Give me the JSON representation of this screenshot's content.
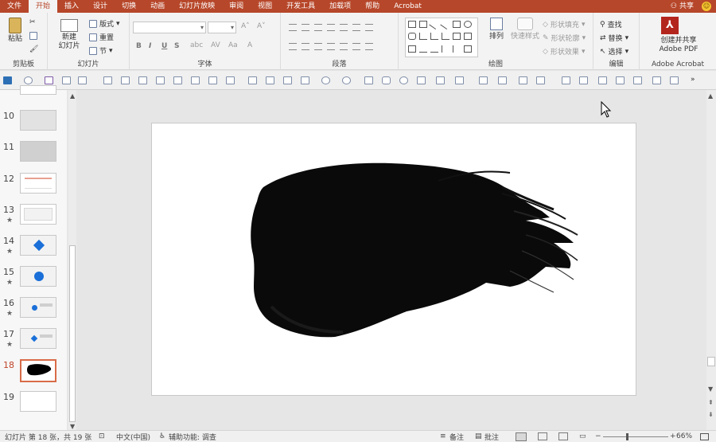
{
  "tabs": [
    "文件",
    "开始",
    "插入",
    "设计",
    "切换",
    "动画",
    "幻灯片放映",
    "审阅",
    "视图",
    "开发工具",
    "加载项",
    "帮助",
    "Acrobat"
  ],
  "active_tab": "开始",
  "share_label": "共享",
  "ribbon": {
    "clipboard": {
      "paste": "粘贴",
      "label": "剪贴板"
    },
    "slides": {
      "new_slide_line1": "新建",
      "new_slide_line2": "幻灯片",
      "layout": "版式",
      "reset": "重置",
      "section": "节",
      "label": "幻灯片"
    },
    "font": {
      "bold": "B",
      "italic": "I",
      "underline": "U",
      "strike": "S",
      "label": "字体"
    },
    "paragraph": {
      "label": "段落"
    },
    "drawing": {
      "arrange": "排列",
      "quick_styles": "快速样式",
      "shape_fill": "形状填充",
      "shape_outline": "形状轮廓",
      "shape_effects": "形状效果",
      "label": "绘图"
    },
    "editing": {
      "find": "查找",
      "replace": "替换",
      "select": "选择",
      "label": "编辑"
    },
    "acrobat": {
      "create_line1": "创建并共享",
      "create_line2": "Adobe PDF",
      "label": "Adobe Acrobat"
    }
  },
  "thumbnails": [
    {
      "num": "10",
      "star": ""
    },
    {
      "num": "11",
      "star": ""
    },
    {
      "num": "12",
      "star": ""
    },
    {
      "num": "13",
      "star": "★"
    },
    {
      "num": "14",
      "star": "★"
    },
    {
      "num": "15",
      "star": "★"
    },
    {
      "num": "16",
      "star": "★"
    },
    {
      "num": "17",
      "star": "★"
    },
    {
      "num": "18",
      "star": ""
    },
    {
      "num": "19",
      "star": ""
    }
  ],
  "status": {
    "slide_info": "幻灯片 第 18 张，共 19 张",
    "language": "中文(中国)",
    "accessibility": "辅助功能: 调查",
    "notes": "备注",
    "comments": "批注",
    "zoom": "66%"
  },
  "colors": {
    "accent": "#b7472a",
    "selection": "#d86c49"
  }
}
